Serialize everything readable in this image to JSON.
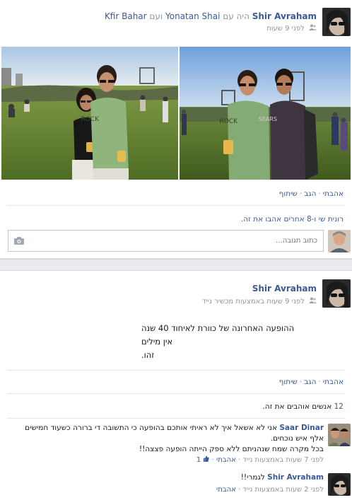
{
  "post1": {
    "author": "Shir Avraham",
    "with_text": "היה עם",
    "tagged1": "Yonatan Shai",
    "and_text": "ועם",
    "tagged2": "Kfir Bahar",
    "time": "לפני 9 שעות",
    "privacy_icon": "friends-icon",
    "actions": {
      "like": "אהבתי",
      "comment": "הגב",
      "share": "שיתוף"
    },
    "likes_summary": "רונית שי ו-8 אחרים אהבו את זה.",
    "comment_placeholder": "כתוב תגובה..."
  },
  "post2": {
    "author": "Shir Avraham",
    "time": "לפני 9 שעות באמצעות מכשיר נייד",
    "privacy_icon": "friends-icon",
    "body_lines": [
      "ההופעה האחרונה של כוורת לאיחוד 40 שנה",
      "אין מילים",
      "זהו."
    ],
    "actions": {
      "like": "אהבתי",
      "comment": "הגב",
      "share": "שיתוף"
    },
    "likes_count": "12",
    "likes_text": "אנשים אוהבים את זה.",
    "comments": [
      {
        "author": "Saar Dinar",
        "text": "אני לא אשאל איך לא ראיתי אותכם בהופעה כי התשובה די ברורה כשעוד חמישים אלף איש נוכחים.",
        "text2": "בכל מקרה שמח שנהניתם ללא ספק הייתה הופעה פצצה!!",
        "time": "לפני 7 שעות באמצעות נייד",
        "like_label": "אהבתי",
        "like_count": "1"
      },
      {
        "author": "Shir Avraham",
        "text": "לגמרי!!",
        "time": "לפני 2 שעות באמצעות נייד",
        "like_label": "אהבתי"
      }
    ]
  },
  "colors": {
    "link": "#3b5998",
    "muted": "#90949c",
    "separator": "#e9ebee"
  }
}
